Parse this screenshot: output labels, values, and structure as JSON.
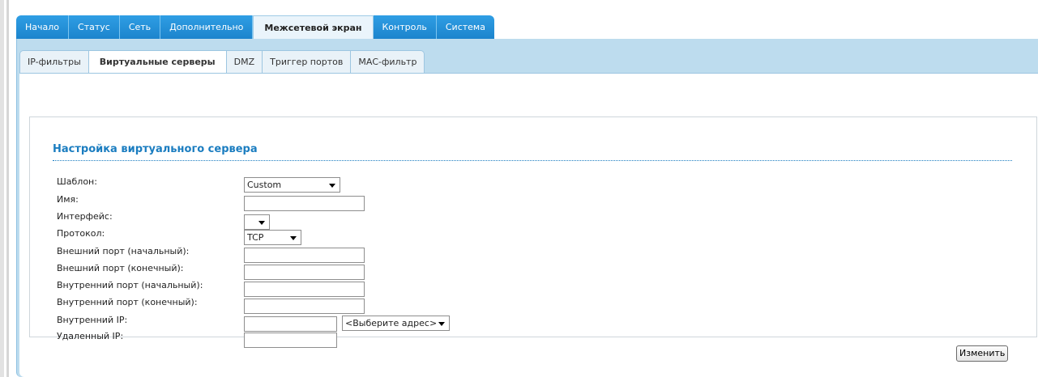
{
  "main_tabs": [
    {
      "label": "Начало"
    },
    {
      "label": "Статус"
    },
    {
      "label": "Сеть"
    },
    {
      "label": "Дополнительно"
    },
    {
      "label": "Межсетевой экран",
      "active": true
    },
    {
      "label": "Контроль"
    },
    {
      "label": "Система"
    }
  ],
  "sub_tabs": [
    {
      "label": "IP-фильтры"
    },
    {
      "label": "Виртуальные серверы",
      "active": true
    },
    {
      "label": "DMZ"
    },
    {
      "label": "Триггер портов"
    },
    {
      "label": "МАС-фильтр"
    }
  ],
  "section": {
    "title": "Настройка виртуального сервера"
  },
  "form": {
    "template": {
      "label": "Шаблон:",
      "value": "Custom"
    },
    "name": {
      "label": "Имя:",
      "value": ""
    },
    "interface": {
      "label": "Интерфейс:",
      "value": ""
    },
    "protocol": {
      "label": "Протокол:",
      "value": "TCP"
    },
    "ext_port_start": {
      "label": "Внешний порт (начальный):",
      "value": ""
    },
    "ext_port_end": {
      "label": "Внешний порт (конечный):",
      "value": ""
    },
    "int_port_start": {
      "label": "Внутренний порт (начальный):",
      "value": ""
    },
    "int_port_end": {
      "label": "Внутренний порт (конечный):",
      "value": ""
    },
    "internal_ip": {
      "label": "Внутренний IP:",
      "value": "",
      "select_value": "<Выберите адрес>"
    },
    "remote_ip": {
      "label": "Удаленный IP:",
      "value": ""
    }
  },
  "actions": {
    "change_label": "Изменить"
  },
  "colors": {
    "accent": "#1b83cc",
    "title": "#1b7dc0",
    "frame": "#bddcee"
  }
}
